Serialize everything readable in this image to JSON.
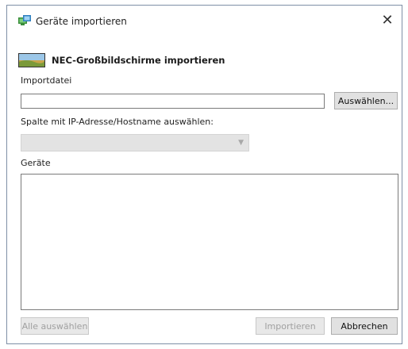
{
  "window": {
    "title": "Geräte importieren",
    "close_glyph": "✕"
  },
  "header": {
    "title": "NEC-Großbildschirme importieren",
    "icon": "monitor-landscape-icon"
  },
  "import_file": {
    "label": "Importdatei",
    "value": "",
    "browse_label": "Auswählen..."
  },
  "column": {
    "label": "Spalte mit IP-Adresse/Hostname auswählen:",
    "selected": ""
  },
  "devices": {
    "label": "Geräte",
    "items": []
  },
  "footer": {
    "select_all_label": "Alle auswählen",
    "import_label": "Importieren",
    "cancel_label": "Abbrechen"
  },
  "colors": {
    "accent": "#2e8b57",
    "window_border": "#7f8fa6",
    "disabled_text": "#a0a0a0"
  }
}
